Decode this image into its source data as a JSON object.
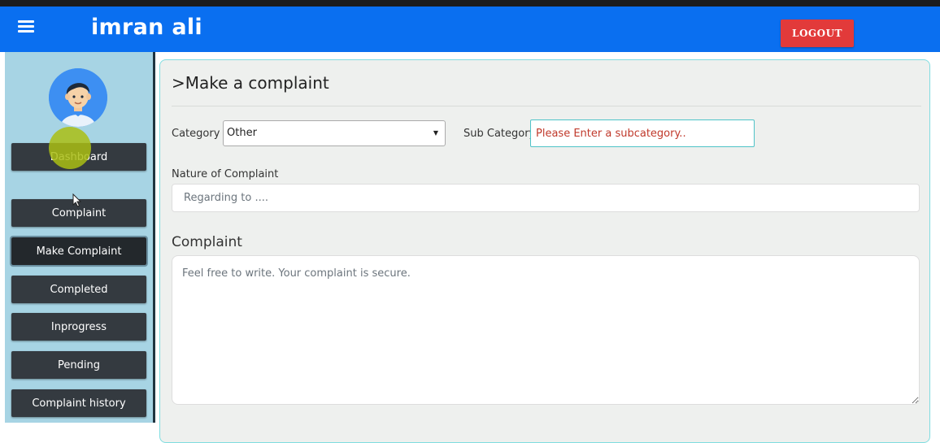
{
  "header": {
    "user_name": "imran ali",
    "logout_label": "LOGOUT",
    "menu_icon": "hamburger-icon",
    "bg_color": "#0a6ff0"
  },
  "sidebar": {
    "avatar_icon": "user-avatar-icon",
    "items": [
      {
        "label": "Dashboard"
      },
      {
        "label": "Complaint"
      },
      {
        "label": "Make Complaint",
        "active": true
      },
      {
        "label": "Completed"
      },
      {
        "label": "Inprogress"
      },
      {
        "label": "Pending"
      },
      {
        "label": "Complaint history"
      }
    ]
  },
  "form": {
    "title": ">Make a complaint",
    "category_label": "Category",
    "category_value": "Other",
    "subcategory_label": "Sub Category",
    "subcategory_placeholder": "Please Enter a subcategory..",
    "nature_label": "Nature of Complaint",
    "nature_placeholder": "Regarding to ....",
    "complaint_label": "Complaint",
    "complaint_placeholder": "Feel free to write. Your complaint is secure."
  },
  "colors": {
    "accent": "#0a6ff0",
    "logout": "#e23a3a",
    "sidebar_bg": "#a7d4e4",
    "nav_button": "#343a40",
    "subcategory_text": "#c0392b"
  }
}
